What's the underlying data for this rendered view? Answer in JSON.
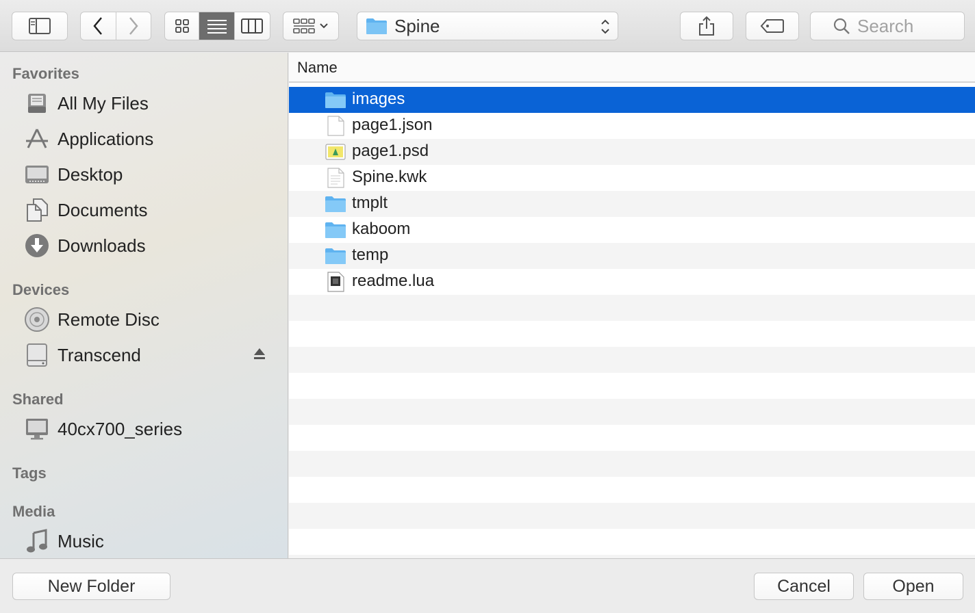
{
  "toolbar": {
    "location": "Spine",
    "search_placeholder": "Search"
  },
  "sidebar": {
    "sections": {
      "favorites": "Favorites",
      "devices": "Devices",
      "shared": "Shared",
      "tags": "Tags",
      "media": "Media"
    },
    "favorites": [
      {
        "label": "All My Files",
        "icon": "all-files-icon"
      },
      {
        "label": "Applications",
        "icon": "applications-icon"
      },
      {
        "label": "Desktop",
        "icon": "desktop-icon"
      },
      {
        "label": "Documents",
        "icon": "documents-icon"
      },
      {
        "label": "Downloads",
        "icon": "downloads-icon"
      }
    ],
    "devices": [
      {
        "label": "Remote Disc",
        "icon": "disc-icon"
      },
      {
        "label": "Transcend",
        "icon": "drive-icon"
      }
    ],
    "shared": [
      {
        "label": "40cx700_series",
        "icon": "monitor-icon"
      }
    ],
    "media": [
      {
        "label": "Music",
        "icon": "music-icon"
      }
    ]
  },
  "list": {
    "column_name": "Name",
    "files": [
      {
        "name": "images",
        "type": "folder",
        "selected": true
      },
      {
        "name": "page1.json",
        "type": "file"
      },
      {
        "name": "page1.psd",
        "type": "image"
      },
      {
        "name": "Spine.kwk",
        "type": "text"
      },
      {
        "name": "tmplt",
        "type": "folder"
      },
      {
        "name": "kaboom",
        "type": "folder"
      },
      {
        "name": "temp",
        "type": "folder"
      },
      {
        "name": "readme.lua",
        "type": "lua"
      }
    ]
  },
  "footer": {
    "new_folder": "New Folder",
    "cancel": "Cancel",
    "open": "Open"
  },
  "colors": {
    "selection": "#0a63d6",
    "folder": "#5fb3f0"
  }
}
